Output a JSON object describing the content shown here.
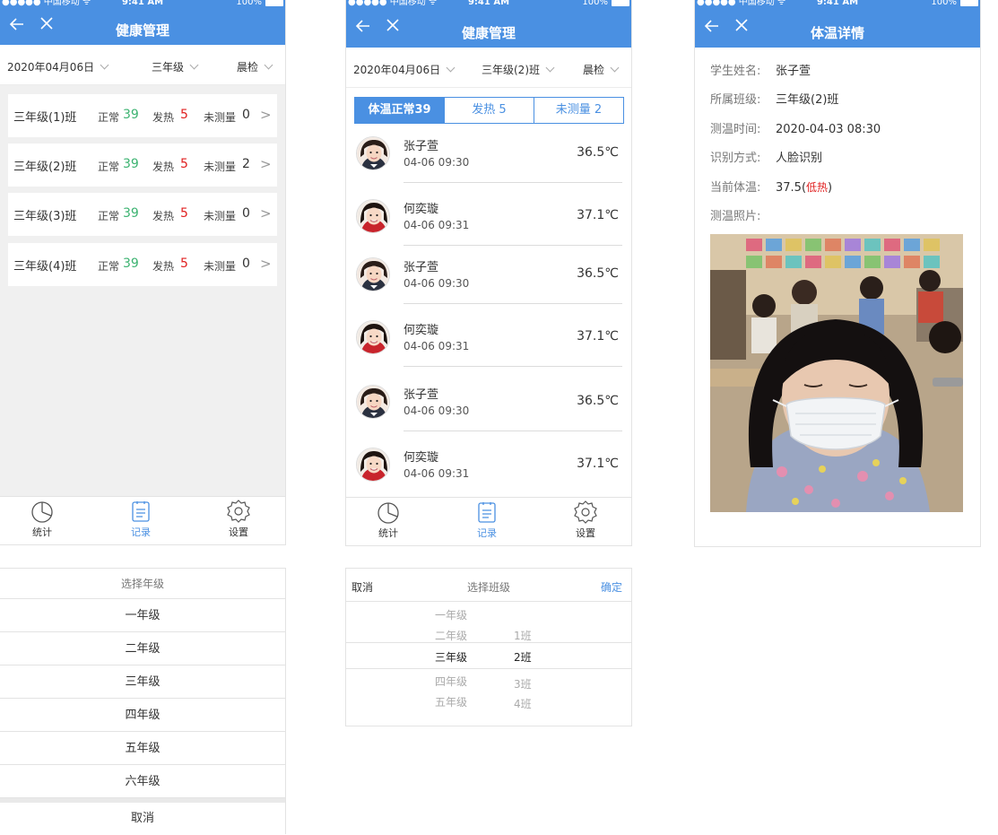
{
  "status": {
    "carrier": "●●●●● 中国移动 ᯤ",
    "time": "9:41 AM",
    "battery": "100%"
  },
  "screen1": {
    "title": "健康管理",
    "filters": {
      "date": "2020年04月06日",
      "grade": "三年级",
      "check": "晨检"
    },
    "rows": [
      {
        "name": "三年级(1)班",
        "normal_label": "正常",
        "normal": "39",
        "fever_label": "发热",
        "fever": "5",
        "unmeasured_label": "未测量",
        "unmeasured": "0"
      },
      {
        "name": "三年级(2)班",
        "normal_label": "正常",
        "normal": "39",
        "fever_label": "发热",
        "fever": "5",
        "unmeasured_label": "未测量",
        "unmeasured": "2"
      },
      {
        "name": "三年级(3)班",
        "normal_label": "正常",
        "normal": "39",
        "fever_label": "发热",
        "fever": "5",
        "unmeasured_label": "未测量",
        "unmeasured": "0"
      },
      {
        "name": "三年级(4)班",
        "normal_label": "正常",
        "normal": "39",
        "fever_label": "发热",
        "fever": "5",
        "unmeasured_label": "未测量",
        "unmeasured": "0"
      }
    ],
    "row_arrow": ">"
  },
  "tabs": {
    "stats": "统计",
    "records": "记录",
    "settings": "设置"
  },
  "screen2": {
    "title": "健康管理",
    "filters": {
      "date": "2020年04月06日",
      "class": "三年级(2)班",
      "check": "晨检"
    },
    "segments": [
      "体温正常39",
      "发热 5",
      "未测量 2"
    ],
    "records": [
      {
        "name": "张子萱",
        "time": "04-06 09:30",
        "temp": "36.5℃"
      },
      {
        "name": "何奕璇",
        "time": "04-06 09:31",
        "temp": "37.1℃"
      },
      {
        "name": "张子萱",
        "time": "04-06 09:30",
        "temp": "36.5℃"
      },
      {
        "name": "何奕璇",
        "time": "04-06 09:31",
        "temp": "37.1℃"
      },
      {
        "name": "张子萱",
        "time": "04-06 09:30",
        "temp": "36.5℃"
      },
      {
        "name": "何奕璇",
        "time": "04-06 09:31",
        "temp": "37.1℃"
      }
    ]
  },
  "screen3": {
    "title": "体温详情",
    "fields": [
      {
        "key": "学生姓名:",
        "value": "张子萱"
      },
      {
        "key": "所属班级:",
        "value": "三年级(2)班"
      },
      {
        "key": "测温时间:",
        "value": "2020-04-03  08:30"
      },
      {
        "key": "识别方式:",
        "value": "人脸识别"
      }
    ],
    "temp_key": "当前体温:",
    "temp_value": "37.5(",
    "temp_note": "低热",
    "temp_close": ")",
    "photo_key": "测温照片:"
  },
  "grade_sheet": {
    "title": "选择年级",
    "options": [
      "一年级",
      "二年级",
      "三年级",
      "四年级",
      "五年级",
      "六年级"
    ],
    "cancel": "取消"
  },
  "class_picker": {
    "cancel": "取消",
    "title": "选择班级",
    "confirm": "确定",
    "grades": [
      "一年级",
      "二年级",
      "三年级",
      "四年级",
      "五年级"
    ],
    "classes": [
      "1班",
      "2班",
      "3班",
      "4班"
    ]
  },
  "colors": {
    "primary": "#4a90e2",
    "normal": "#3cb371",
    "fever": "#e02020"
  }
}
